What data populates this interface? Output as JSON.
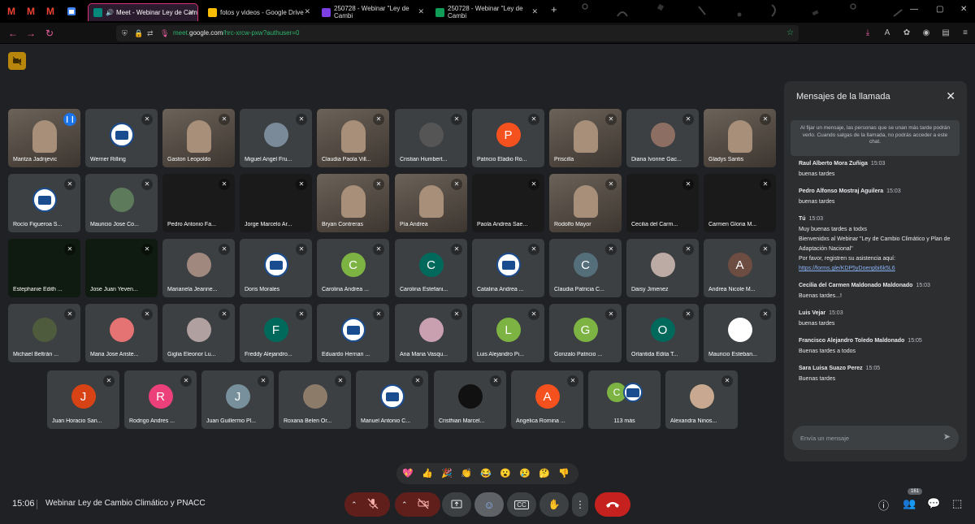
{
  "browser": {
    "tabs": [
      {
        "title": "Meet - Webinar Ley de Cam",
        "color": "#00897b"
      },
      {
        "title": "fotos y videos - Google Drive",
        "color": "#fbbc04"
      },
      {
        "title": "250728 - Webinar \"Ley de Cambi",
        "color": "#7b3fe4"
      },
      {
        "title": "250728 - Webinar \"Ley de Cambi",
        "color": "#0f9d58"
      }
    ],
    "new_tab": "+",
    "url_prefix": "meet.",
    "url_host": "google.com",
    "url_path": "/hrc-xrcw-pxw?authuser=0"
  },
  "meeting": {
    "time": "15:06",
    "title": "Webinar Ley de Cambio Climático y PNACC",
    "participant_count": "161"
  },
  "participants": [
    {
      "name": "Maritza Jadrijevic",
      "kind": "photo",
      "speaking": true
    },
    {
      "name": "Werner Rilling",
      "kind": "logo"
    },
    {
      "name": "Gaston Leopoldo",
      "kind": "photo"
    },
    {
      "name": "Miguel Angel Fru...",
      "kind": "avatar",
      "initial": "",
      "color": "#7a8a99"
    },
    {
      "name": "Claudia Paola Vill...",
      "kind": "photo"
    },
    {
      "name": "Cristian Humbert...",
      "kind": "avatar",
      "initial": "",
      "color": "#555"
    },
    {
      "name": "Patricio Eladio Ro...",
      "kind": "avatar",
      "initial": "P",
      "color": "#f4511e"
    },
    {
      "name": "Priscilla",
      "kind": "photo"
    },
    {
      "name": "Diana Ivonne Gac...",
      "kind": "avatar",
      "initial": "",
      "color": "#8d6e63"
    },
    {
      "name": "Gladys Santis",
      "kind": "photo"
    },
    {
      "name": "Rocío Figueroa S...",
      "kind": "logo"
    },
    {
      "name": "Mauricio Jose Co...",
      "kind": "avatar",
      "initial": "",
      "color": "#5d7a5a"
    },
    {
      "name": "Pedro Antonio Fa...",
      "kind": "dark"
    },
    {
      "name": "Jorge Marcelo Ar...",
      "kind": "dark"
    },
    {
      "name": "Bryan Contreras",
      "kind": "photo"
    },
    {
      "name": "Pía Andrea",
      "kind": "photo"
    },
    {
      "name": "Paola Andrea Sae...",
      "kind": "dark"
    },
    {
      "name": "Rodolfo Mayor",
      "kind": "photo"
    },
    {
      "name": "Cecilia del Carm...",
      "kind": "dark"
    },
    {
      "name": "Carmen Gloria M...",
      "kind": "dark"
    },
    {
      "name": "Estephanie Edith ...",
      "kind": "green"
    },
    {
      "name": "Jose Juan Yeven...",
      "kind": "green"
    },
    {
      "name": "Marianela Jeanne...",
      "kind": "avatar",
      "initial": "",
      "color": "#a1887f"
    },
    {
      "name": "Doris Morales",
      "kind": "logo"
    },
    {
      "name": "Carolina Andrea ...",
      "kind": "avatar",
      "initial": "C",
      "color": "#7cb342"
    },
    {
      "name": "Carolina Estefani...",
      "kind": "avatar",
      "initial": "C",
      "color": "#00695c"
    },
    {
      "name": "Catalina Andrea ...",
      "kind": "logo"
    },
    {
      "name": "Claudia Patricia C...",
      "kind": "avatar",
      "initial": "C",
      "color": "#546e7a"
    },
    {
      "name": "Daisy Jimenez",
      "kind": "avatar",
      "initial": "",
      "color": "#bcaaa4"
    },
    {
      "name": "Andrea Nicole M...",
      "kind": "avatar",
      "initial": "A",
      "color": "#6d4c41"
    },
    {
      "name": "Michael Beltrán ...",
      "kind": "avatar",
      "initial": "",
      "color": "#4e5b3c"
    },
    {
      "name": "Maria Jose Ariste...",
      "kind": "avatar",
      "initial": "",
      "color": "#e57373"
    },
    {
      "name": "Giglia Eleonor Lu...",
      "kind": "avatar",
      "initial": "",
      "color": "#b0a0a0"
    },
    {
      "name": "Freddy Alejandro...",
      "kind": "avatar",
      "initial": "F",
      "color": "#00695c"
    },
    {
      "name": "Eduardo Hernan ...",
      "kind": "logo"
    },
    {
      "name": "Ana Maria Vasqu...",
      "kind": "avatar",
      "initial": "",
      "color": "#c9a0b0"
    },
    {
      "name": "Luis Alejandro Pi...",
      "kind": "avatar",
      "initial": "L",
      "color": "#7cb342"
    },
    {
      "name": "Gonzalo Patricio ...",
      "kind": "avatar",
      "initial": "G",
      "color": "#7cb342"
    },
    {
      "name": "Orlantida Edita T...",
      "kind": "avatar",
      "initial": "O",
      "color": "#00695c"
    },
    {
      "name": "Mauricio Esteban...",
      "kind": "avatar",
      "initial": "",
      "color": "#ffffff"
    },
    {
      "name": "Juan Horacio San...",
      "kind": "avatar",
      "initial": "J",
      "color": "#d84315"
    },
    {
      "name": "Rodrigo Andres ...",
      "kind": "avatar",
      "initial": "R",
      "color": "#ec407a"
    },
    {
      "name": "Juan Guillermo Pl...",
      "kind": "avatar",
      "initial": "J",
      "color": "#78909c"
    },
    {
      "name": "Roxana Belen Or...",
      "kind": "avatar",
      "initial": "",
      "color": "#8d7b6a"
    },
    {
      "name": "Manuel Antonio C...",
      "kind": "logo"
    },
    {
      "name": "Cristhian Marcel...",
      "kind": "avatar",
      "initial": "",
      "color": "#111111"
    },
    {
      "name": "Angelica Romina ...",
      "kind": "avatar",
      "initial": "A",
      "color": "#f4511e"
    },
    {
      "name": "113 más",
      "kind": "more"
    },
    {
      "name": "Alexandra Ninos...",
      "kind": "avatar",
      "initial": "",
      "color": "#c8a890"
    }
  ],
  "chat": {
    "title": "Mensajes de la llamada",
    "notice": "Al fijar un mensaje, las personas que se unan más tarde podrán verlo. Cuando salgas de la llamada, no podrás acceder a este chat.",
    "messages": [
      {
        "sender": "Raul Alberto Mora Zuñiga",
        "time": "15:03",
        "lines": [
          "buenas tardes"
        ]
      },
      {
        "sender": "Pedro Alfonso Mostraj Aguilera",
        "time": "15:03",
        "lines": [
          "buenas tardes"
        ]
      },
      {
        "sender": "Tú",
        "time": "15:03",
        "lines": [
          "Muy buenas tardes a todxs",
          "Bienvenidxs al Webinar \"Ley de Cambio Climático y Plan de Adaptación Nacional\"",
          "Por favor, registren su asistencia aquí:"
        ],
        "link": "https://forms.gle/KDP5yDoenpbi6k5L6"
      },
      {
        "sender": "Cecilia del Carmen Maldonado Maldonado",
        "time": "15:03",
        "lines": [
          "Buenas tardes...!"
        ]
      },
      {
        "sender": "Luis Vejar",
        "time": "15:03",
        "lines": [
          "buenas tardes"
        ]
      },
      {
        "sender": "Francisco Alejandro Toledo Maldonado",
        "time": "15:05",
        "lines": [
          "Buenas tardes a todos"
        ]
      },
      {
        "sender": "Sara Luisa Suazo Perez",
        "time": "15:05",
        "lines": [
          "Buenas tardes"
        ]
      }
    ],
    "placeholder": "Envía un mensaje"
  },
  "reactions": [
    "💖",
    "👍",
    "🎉",
    "👏",
    "😂",
    "😮",
    "😢",
    "🤔",
    "👎"
  ],
  "colors": {
    "bg": "#202124",
    "tile": "#3c4043",
    "accent_end": "#c5221f",
    "muted_red": "#ea4335"
  }
}
